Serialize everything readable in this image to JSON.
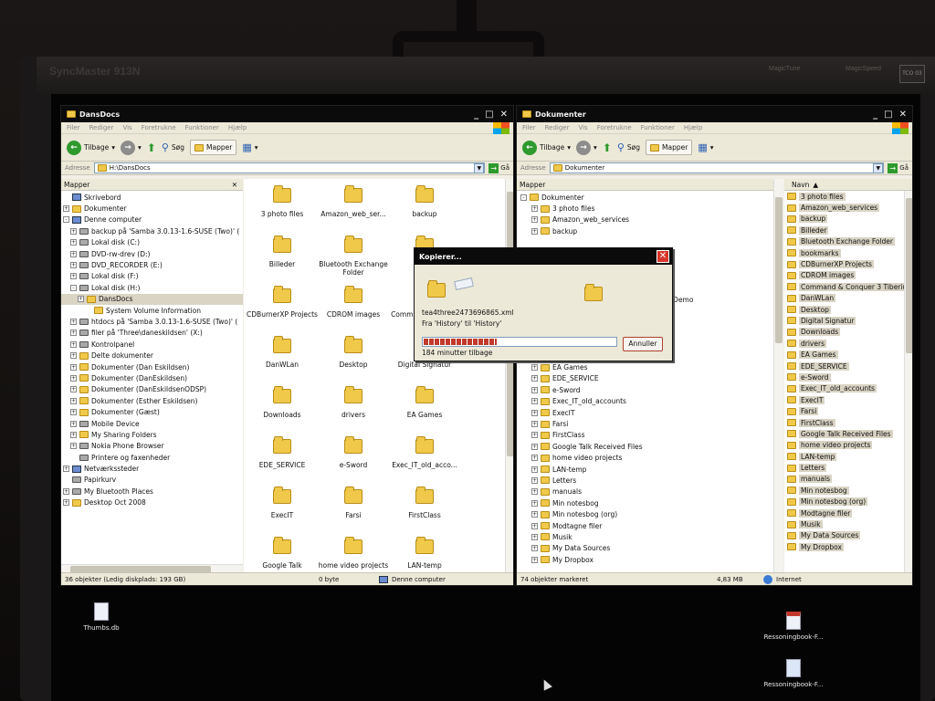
{
  "monitor": {
    "brand": "SyncMaster 913N",
    "magic_left": "MagicTune",
    "magic_right": "MagicSpeed",
    "badge": "TCO 03"
  },
  "colors": {
    "titlebar": "#0b0b0b",
    "toolbar": "#ece9d8",
    "folder": "#f0c94a",
    "progress": "#c0392b",
    "close": "#d8372b"
  },
  "left_window": {
    "title": "DansDocs",
    "menu": [
      "Filer",
      "Rediger",
      "Vis",
      "Foretrukne",
      "Funktioner",
      "Hjælp"
    ],
    "toolbar": {
      "back": "Tilbage",
      "search": "Søg",
      "folders": "Mapper"
    },
    "address_label": "Adresse",
    "address": "H:\\DansDocs",
    "go": "Gå",
    "tree_header": "Mapper",
    "tree": [
      {
        "label": "Skrivebord",
        "icon": "desktop-icon",
        "pm": ""
      },
      {
        "label": "Dokumenter",
        "icon": "folder-icon",
        "pm": "+"
      },
      {
        "label": "Denne computer",
        "icon": "computer-icon",
        "pm": "-"
      },
      {
        "label": "backup på 'Samba 3.0.13-1.6-SUSE (Two)' (",
        "icon": "network-drive-icon",
        "pm": "+"
      },
      {
        "label": "Lokal disk (C:)",
        "icon": "drive-icon",
        "pm": "+"
      },
      {
        "label": "DVD-rw-drev (D:)",
        "icon": "cd-drive-icon",
        "pm": "+"
      },
      {
        "label": "DVD_RECORDER (E:)",
        "icon": "cd-drive-icon",
        "pm": "+"
      },
      {
        "label": "Lokal disk (F:)",
        "icon": "drive-icon",
        "pm": "+"
      },
      {
        "label": "Lokal disk (H:)",
        "icon": "drive-icon",
        "pm": "-"
      },
      {
        "label": "DansDocs",
        "icon": "folder-icon",
        "pm": "+"
      },
      {
        "label": "System Volume Information",
        "icon": "folder-icon",
        "pm": ""
      },
      {
        "label": "htdocs på 'Samba 3.0.13-1.6-SUSE (Two)' (",
        "icon": "network-drive-icon",
        "pm": "+"
      },
      {
        "label": "filer på 'Three\\daneskildsen' (X:)",
        "icon": "network-drive-icon",
        "pm": "+"
      },
      {
        "label": "Kontrolpanel",
        "icon": "control-panel-icon",
        "pm": "+"
      },
      {
        "label": "Delte dokumenter",
        "icon": "folder-icon",
        "pm": "+"
      },
      {
        "label": "Dokumenter (Dan Eskildsen)",
        "icon": "folder-icon",
        "pm": "+"
      },
      {
        "label": "Dokumenter (DanEskildsen)",
        "icon": "folder-icon",
        "pm": "+"
      },
      {
        "label": "Dokumenter (DanEskildsenODSP)",
        "icon": "folder-icon",
        "pm": "+"
      },
      {
        "label": "Dokumenter (Esther Eskildsen)",
        "icon": "folder-icon",
        "pm": "+"
      },
      {
        "label": "Dokumenter (Gæst)",
        "icon": "folder-icon",
        "pm": "+"
      },
      {
        "label": "Mobile Device",
        "icon": "mobile-device-icon",
        "pm": "+"
      },
      {
        "label": "My Sharing Folders",
        "icon": "shared-folder-icon",
        "pm": "+"
      },
      {
        "label": "Nokia Phone Browser",
        "icon": "phone-icon",
        "pm": "+"
      },
      {
        "label": "Printere og faxenheder",
        "icon": "printer-icon",
        "pm": ""
      },
      {
        "label": "Netværkssteder",
        "icon": "network-icon",
        "pm": "+"
      },
      {
        "label": "Papirkurv",
        "icon": "recycle-bin-icon",
        "pm": ""
      },
      {
        "label": "My Bluetooth Places",
        "icon": "bluetooth-icon",
        "pm": "+"
      },
      {
        "label": "Desktop Oct 2008",
        "icon": "folder-icon",
        "pm": "+"
      }
    ],
    "icons": [
      [
        "3 photo files",
        "Amazon_web_ser...",
        "backup"
      ],
      [
        "Billeder",
        "Bluetooth Exchange Folder",
        "bo..."
      ],
      [
        "CDBurnerXP Projects",
        "CDROM images",
        "Comma... 3 Tiberi..."
      ],
      [
        "DanWLan",
        "Desktop",
        "Digital Signatur"
      ],
      [
        "Downloads",
        "drivers",
        "EA Games"
      ],
      [
        "EDE_SERVICE",
        "e-Sword",
        "Exec_IT_old_acco..."
      ],
      [
        "ExecIT",
        "Farsi",
        "FirstClass"
      ],
      [
        "Google Talk",
        "home video projects",
        "LAN-temp"
      ]
    ],
    "status": {
      "objects": "36 objekter (Ledig diskplads: 193 GB)",
      "size": "0 byte",
      "zone": "Denne computer"
    }
  },
  "right_window": {
    "title": "Dokumenter",
    "menu": [
      "Filer",
      "Rediger",
      "Vis",
      "Foretrukne",
      "Funktioner",
      "Hjælp"
    ],
    "toolbar": {
      "back": "Tilbage",
      "search": "Søg",
      "folders": "Mapper"
    },
    "address_label": "Adresse",
    "address": "Dokumenter",
    "go": "Gå",
    "tree_header": "Mapper",
    "tree_top": [
      "Dokumenter",
      "3 photo files",
      "Amazon_web_services",
      "backup"
    ],
    "tree_bottom": [
      "drivers",
      "EA Games",
      "EDE_SERVICE",
      "e-Sword",
      "Exec_IT_old_accounts",
      "ExecIT",
      "Farsi",
      "FirstClass",
      "Google Talk Received Files",
      "home video projects",
      "LAN-temp",
      "Letters",
      "manuals",
      "Min notesbog",
      "Min notesbog (org)",
      "Modtagne filer",
      "Musik",
      "My Data Sources",
      "My Dropbox"
    ],
    "partial_text": "Ä'ars Demo",
    "list_header": "Navn",
    "list": [
      "3 photo files",
      "Amazon_web_services",
      "backup",
      "Billeder",
      "Bluetooth Exchange Folder",
      "bookmarks",
      "CDBurnerXP Projects",
      "CDROM images",
      "Command & Conquer 3 Tiberiun",
      "DanWLan",
      "Desktop",
      "Digital Signatur",
      "Downloads",
      "drivers",
      "EA Games",
      "EDE_SERVICE",
      "e-Sword",
      "Exec_IT_old_accounts",
      "ExecIT",
      "Farsi",
      "FirstClass",
      "Google Talk Received Files",
      "home video projects",
      "LAN-temp",
      "Letters",
      "manuals",
      "Min notesbog",
      "Min notesbog (org)",
      "Modtagne filer",
      "Musik",
      "My Data Sources",
      "My Dropbox"
    ],
    "status": {
      "objects": "74 objekter markeret",
      "size": "4,83 MB",
      "zone": "Internet"
    }
  },
  "copy_dialog": {
    "title": "Kopierer...",
    "file": "tea4three2473696865.xml",
    "from_to": "Fra 'History' til 'History'",
    "remaining": "184 minutter tilbage",
    "progress": 0.38,
    "cancel": "Annuller"
  },
  "desktop": {
    "thumbs": "Thumbs.db",
    "pdf": "Ressoningbook-F...",
    "doc": "Ressoningbook-F..."
  }
}
